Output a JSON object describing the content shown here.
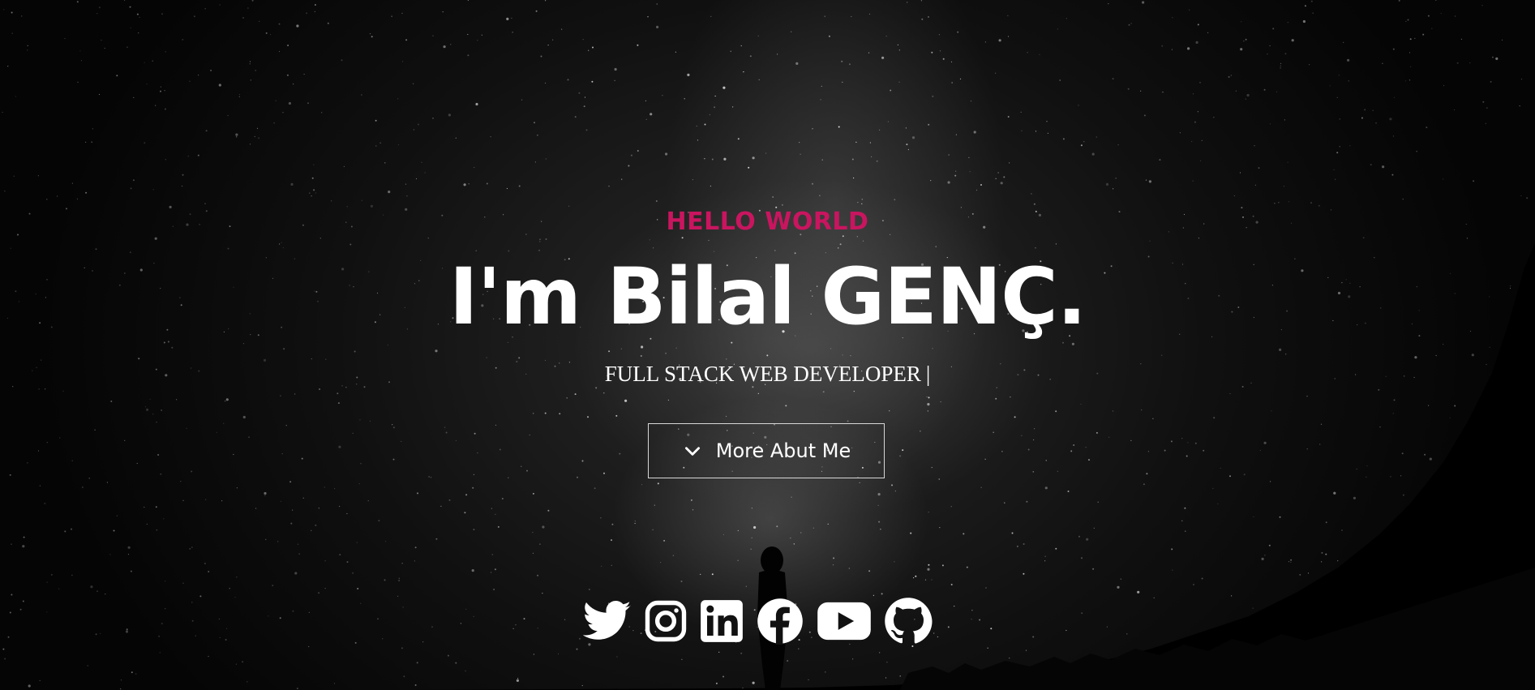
{
  "hero": {
    "eyebrow": "HELLO WORLD",
    "headline": "I'm Bilal GENÇ.",
    "role": "FULL STACK WEB DEVELOPER",
    "cursor": "|",
    "cta_label": "More Abut Me",
    "cta_icon": "chevron-down-icon"
  },
  "socials": [
    {
      "icon": "twitter-icon"
    },
    {
      "icon": "instagram-icon"
    },
    {
      "icon": "linkedin-icon"
    },
    {
      "icon": "facebook-icon"
    },
    {
      "icon": "youtube-icon"
    },
    {
      "icon": "github-icon"
    }
  ],
  "colors": {
    "accent": "#c9155f",
    "text": "#ffffff",
    "background": "#000000"
  }
}
